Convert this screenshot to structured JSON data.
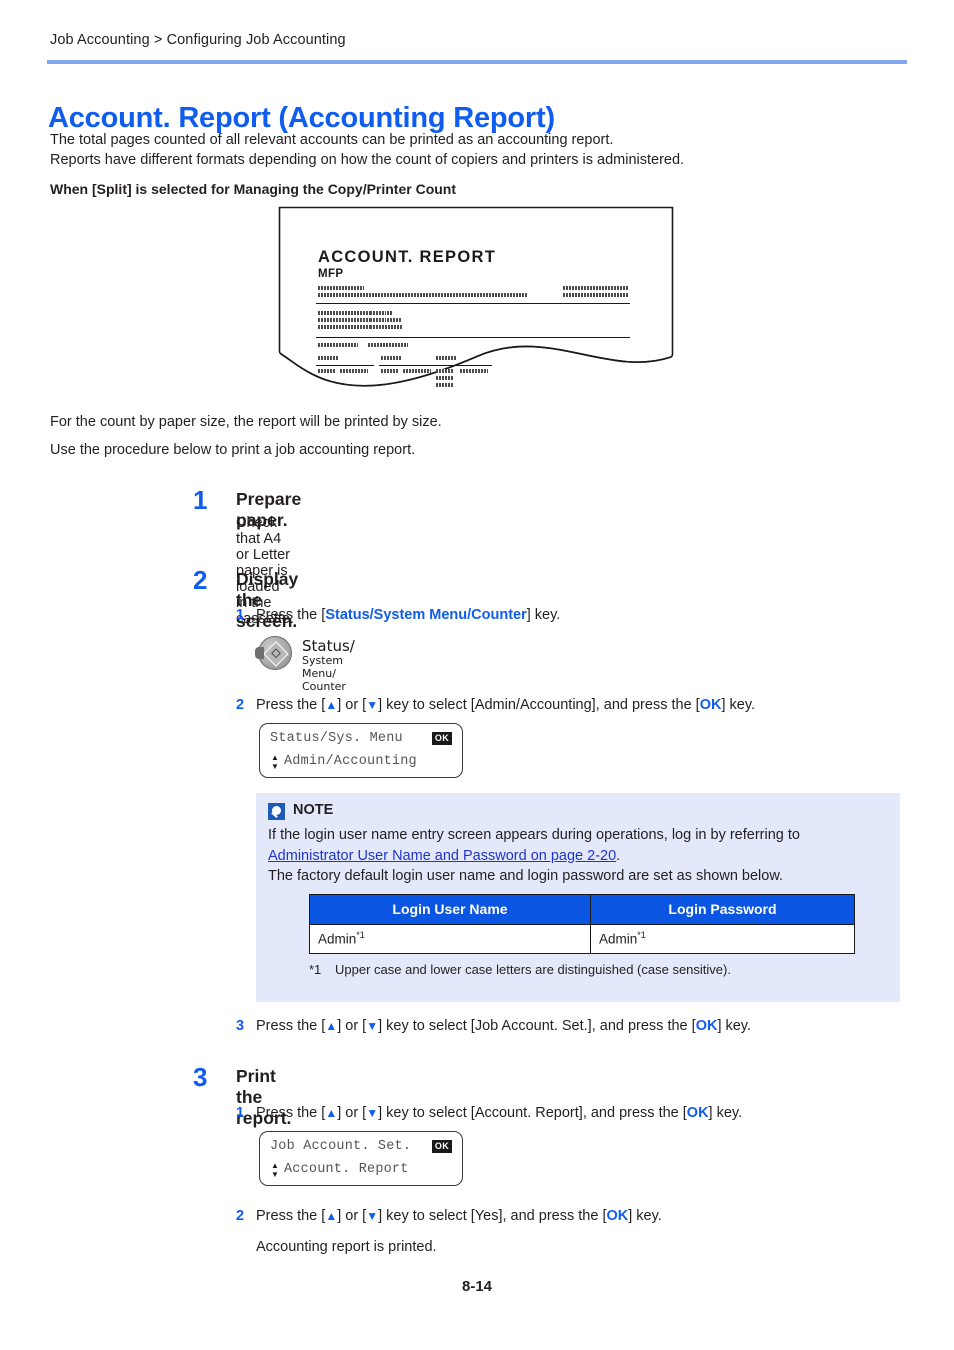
{
  "header": {
    "breadcrumb": "Job Accounting > Configuring Job Accounting"
  },
  "title": "Account. Report (Accounting Report)",
  "intro": {
    "line1": "The total pages counted of all relevant accounts can be printed as an accounting report.",
    "line2": "Reports have different formats depending on how the count of copiers and printers is administered.",
    "subhead": "When [Split] is selected for Managing the Copy/Printer Count"
  },
  "report_figure": {
    "title": "ACCOUNT. REPORT",
    "subtitle": "MFP"
  },
  "paragraphs": {
    "by_size": "For the count by paper size, the report will be printed by size.",
    "procedure": "Use the procedure below to print a job accounting report."
  },
  "steps": [
    {
      "number": "1",
      "title": "Prepare paper.",
      "body": "Check that A4 or Letter paper is loaded in the cassette."
    },
    {
      "number": "2",
      "title": "Display the screen."
    },
    {
      "number": "3",
      "title": "Print the report."
    }
  ],
  "substeps": {
    "s2_1_num": "1",
    "s2_1_pre": "Press the [",
    "s2_1_key": "Status/System Menu/Counter",
    "s2_1_post": "] key.",
    "s2_2_num": "2",
    "s2_2_a": "Press the [",
    "s2_2_b": "] or [",
    "s2_2_c": "] key to select [Admin/Accounting], and press the [",
    "s2_2_ok": "OK",
    "s2_2_d": "] key.",
    "s2_3_num": "3",
    "s2_3_a": "Press the [",
    "s2_3_b": "] or [",
    "s2_3_c": "] key to select [Job Account. Set.], and press the [",
    "s2_3_ok": "OK",
    "s2_3_d": "] key.",
    "s3_1_num": "1",
    "s3_1_a": "Press the [",
    "s3_1_b": "] or [",
    "s3_1_c": "] key to select [Account. Report], and press the [",
    "s3_1_ok": "OK",
    "s3_1_d": "] key.",
    "s3_2_num": "2",
    "s3_2_a": "Press the [",
    "s3_2_b": "] or [",
    "s3_2_c": "] key to select [Yes], and press the [",
    "s3_2_ok": "OK",
    "s3_2_d": "] key.",
    "s3_2_result": "Accounting report is printed.",
    "arrow_up": "▲",
    "arrow_down": "▼"
  },
  "panel_key": {
    "label_line1": "Status/",
    "label_line2": "System Menu/",
    "label_line3": "Counter"
  },
  "lcd_1": {
    "line1": "Status/Sys. Menu",
    "ok": "OK",
    "line2": "Admin/Accounting",
    "arrow_up": "▲",
    "arrow_down": "▼"
  },
  "lcd_2": {
    "line1": "Job Account. Set.",
    "ok": "OK",
    "line2": "Account. Report",
    "arrow_up": "▲",
    "arrow_down": "▼"
  },
  "note": {
    "title": "NOTE",
    "line1": "If the login user name entry screen appears during operations, log in by referring to",
    "link": "Administrator User Name and Password on page 2-20",
    "line1_end": ".",
    "line2": "The factory default login user name and login password are set as shown below.",
    "table": {
      "headers": [
        "Login User Name",
        "Login Password"
      ],
      "row": [
        "Admin",
        "Admin"
      ],
      "sup": "*1"
    },
    "footnote_mark": "*1",
    "footnote_text": "Upper case and lower case letters are distinguished (case sensitive)."
  },
  "footer": {
    "page_number": "8-14"
  },
  "colors": {
    "accent_blue": "#0f5cf0",
    "rule_blue": "#82a9ee",
    "table_header_blue": "#0a55e2",
    "note_bg": "#e3e9fa",
    "link_blue": "#2233cc"
  }
}
